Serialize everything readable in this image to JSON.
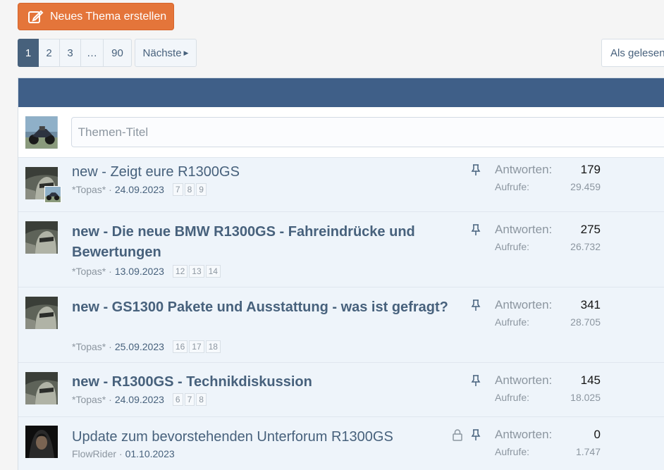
{
  "toolbar": {
    "new_thread_label": "Neues Thema erstellen",
    "mark_read_label": "Als gelesen",
    "accent": "#e4753a"
  },
  "pagination": {
    "pages": [
      "1",
      "2",
      "3",
      "…",
      "90"
    ],
    "current": "1",
    "next_label": "Nächste"
  },
  "quick_thread": {
    "placeholder": "Themen-Titel"
  },
  "threads": [
    {
      "prefix": "new - ",
      "title": "Zeigt eure R1300GS",
      "bold": false,
      "author": "*Topas*",
      "date": "24.09.2023",
      "pages": [
        "7",
        "8",
        "9"
      ],
      "pinned": true,
      "locked": false,
      "replies_label": "Antworten:",
      "replies": "179",
      "views_label": "Aufrufe:",
      "views": "29.459"
    },
    {
      "prefix": "new - ",
      "title": "Die neue BMW R1300GS - Fahreindrücke und Bewertungen",
      "bold": true,
      "author": "*Topas*",
      "date": "13.09.2023",
      "pages": [
        "12",
        "13",
        "14"
      ],
      "pinned": true,
      "locked": false,
      "replies_label": "Antworten:",
      "replies": "275",
      "views_label": "Aufrufe:",
      "views": "26.732"
    },
    {
      "prefix": "new - ",
      "title": "GS1300 Pakete und Ausstattung - was ist gefragt?",
      "bold": true,
      "author": "*Topas*",
      "date": "25.09.2023",
      "pages": [
        "16",
        "17",
        "18"
      ],
      "pinned": true,
      "locked": false,
      "replies_label": "Antworten:",
      "replies": "341",
      "views_label": "Aufrufe:",
      "views": "28.705"
    },
    {
      "prefix": "new - ",
      "title": "R1300GS - Technikdiskussion",
      "bold": true,
      "author": "*Topas*",
      "date": "24.09.2023",
      "pages": [
        "6",
        "7",
        "8"
      ],
      "pinned": true,
      "locked": false,
      "replies_label": "Antworten:",
      "replies": "145",
      "views_label": "Aufrufe:",
      "views": "18.025"
    },
    {
      "prefix": "",
      "title": "Update zum bevorstehenden Unterforum R1300GS",
      "bold": false,
      "author": "FlowRider",
      "date": "01.10.2023",
      "pages": [],
      "pinned": true,
      "locked": true,
      "replies_label": "Antworten:",
      "replies": "0",
      "views_label": "Aufrufe:",
      "views": "1.747"
    }
  ]
}
